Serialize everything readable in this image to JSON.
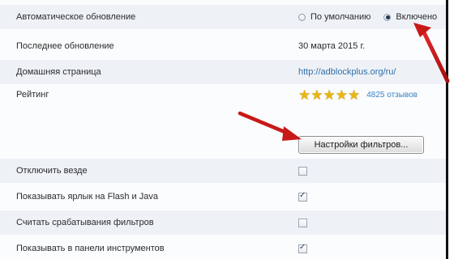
{
  "settings": {
    "auto_update": {
      "label": "Автоматическое обновление",
      "option_default": "По умолчанию",
      "option_on": "Включено"
    },
    "last_update": {
      "label": "Последнее обновление",
      "value": "30 марта 2015 г."
    },
    "homepage": {
      "label": "Домашняя страница",
      "value": "http://adblockplus.org/ru/"
    },
    "rating": {
      "label": "Рейтинг",
      "stars": "★★★★★",
      "reviews": "4825 отзывов"
    },
    "filters_button": "Настройки фильтров...",
    "disable_everywhere": {
      "label": "Отключить везде",
      "checked": false
    },
    "show_flash_java": {
      "label": "Показывать ярлык на Flash и Java",
      "checked": true
    },
    "count_hits": {
      "label": "Считать срабатывания фильтров",
      "checked": false
    },
    "show_toolbar": {
      "label": "Показывать в панели инструментов",
      "checked": true
    }
  },
  "annotation_arrows": {
    "color": "#d21e1e"
  }
}
